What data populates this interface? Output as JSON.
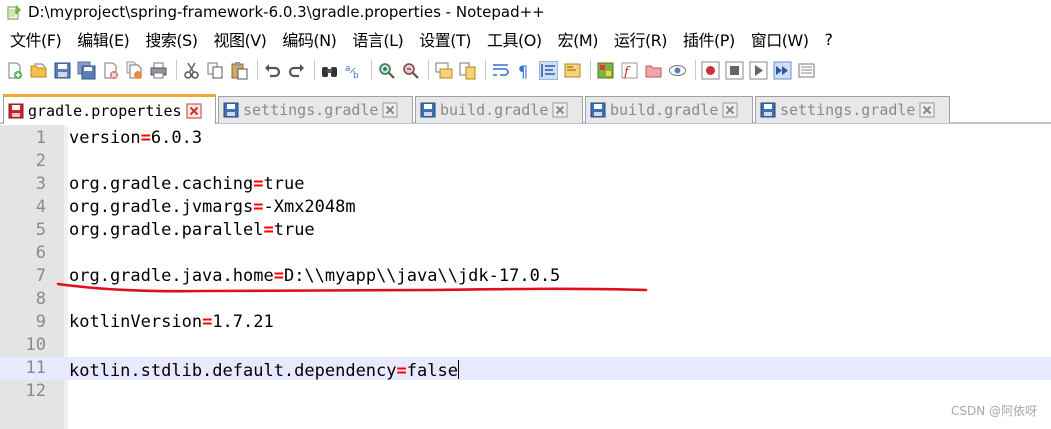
{
  "window": {
    "title": "D:\\myproject\\spring-framework-6.0.3\\gradle.properties - Notepad++"
  },
  "menu": [
    {
      "label": "文件(F)"
    },
    {
      "label": "编辑(E)"
    },
    {
      "label": "搜索(S)"
    },
    {
      "label": "视图(V)"
    },
    {
      "label": "编码(N)"
    },
    {
      "label": "语言(L)"
    },
    {
      "label": "设置(T)"
    },
    {
      "label": "工具(O)"
    },
    {
      "label": "宏(M)"
    },
    {
      "label": "运行(R)"
    },
    {
      "label": "插件(P)"
    },
    {
      "label": "窗口(W)"
    },
    {
      "label": "?"
    }
  ],
  "toolbar": {
    "icons": [
      "new-file-icon",
      "open-file-icon",
      "save-icon",
      "save-all-icon",
      "close-icon",
      "close-all-icon",
      "print-icon",
      "cut-icon",
      "copy-icon",
      "paste-icon",
      "undo-icon",
      "redo-icon",
      "find-icon",
      "replace-icon",
      "zoom-in-icon",
      "zoom-out-icon",
      "sync-vertical-icon",
      "sync-horizontal-icon",
      "word-wrap-icon",
      "show-all-chars-icon",
      "indent-guide-icon",
      "language-icon",
      "doc-map-icon",
      "function-list-icon",
      "folder-workspace-icon",
      "monitoring-icon",
      "record-macro-icon",
      "stop-macro-icon",
      "play-macro-icon",
      "run-macro-multiple-icon",
      "save-macro-icon"
    ]
  },
  "tabs": [
    {
      "label": "gradle.properties",
      "active": true,
      "icon": "save-icon-red"
    },
    {
      "label": "settings.gradle",
      "active": false,
      "icon": "save-icon-blue"
    },
    {
      "label": "build.gradle",
      "active": false,
      "icon": "save-icon-blue"
    },
    {
      "label": "build.gradle",
      "active": false,
      "icon": "save-icon-blue"
    },
    {
      "label": "settings.gradle",
      "active": false,
      "icon": "save-icon-blue"
    }
  ],
  "editor": {
    "lines": [
      {
        "num": "1",
        "key": "version",
        "eq": "=",
        "value": "6.0.3"
      },
      {
        "num": "2",
        "key": "",
        "eq": "",
        "value": ""
      },
      {
        "num": "3",
        "key": "org.gradle.caching",
        "eq": "=",
        "value": "true"
      },
      {
        "num": "4",
        "key": "org.gradle.jvmargs",
        "eq": "=",
        "value": "-Xmx2048m"
      },
      {
        "num": "5",
        "key": "org.gradle.parallel",
        "eq": "=",
        "value": "true"
      },
      {
        "num": "6",
        "key": "",
        "eq": "",
        "value": ""
      },
      {
        "num": "7",
        "key": "org.gradle.java.home",
        "eq": "=",
        "value": "D:\\\\myapp\\\\java\\\\jdk-17.0.5"
      },
      {
        "num": "8",
        "key": "",
        "eq": "",
        "value": ""
      },
      {
        "num": "9",
        "key": "kotlinVersion",
        "eq": "=",
        "value": "1.7.21"
      },
      {
        "num": "10",
        "key": "",
        "eq": "",
        "value": ""
      },
      {
        "num": "11",
        "key": "kotlin.stdlib.default.dependency",
        "eq": "=",
        "value": "false"
      },
      {
        "num": "12",
        "key": "",
        "eq": "",
        "value": ""
      }
    ],
    "current_line": "11",
    "annotation_color": "#e0101a"
  },
  "watermark": "CSDN @阿依呀"
}
